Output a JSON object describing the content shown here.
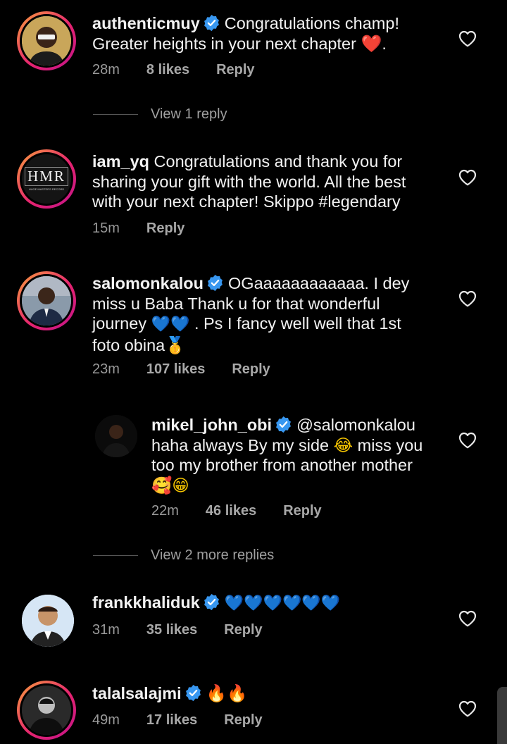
{
  "comments": [
    {
      "username": "authenticmuy",
      "verified": true,
      "text": "Congratulations champ! Greater heights in your next chapter",
      "trail_emoji": "❤️",
      "trail_end": ".",
      "time": "28m",
      "likes": "8 likes",
      "reply": "Reply",
      "view_replies": "View 1 reply"
    },
    {
      "username": "iam_yq",
      "verified": false,
      "text": "Congratulations and thank you for sharing your gift with  the world. All the best with your next chapter!  Skippo #legendary",
      "time": "15m",
      "reply": "Reply",
      "avatar_text": "HMR",
      "avatar_subtext": "HUGE MASTERS RECORD"
    },
    {
      "username": "salomonkalou",
      "verified": true,
      "text_a": "OGaaaaaaaaaaaa. I dey miss u Baba Thank u for that wonderful journey",
      "emoji_a": "💙💙",
      "text_b": ". Ps I fancy well well that 1st foto obina",
      "emoji_b": "🥇",
      "time": "23m",
      "likes": "107 likes",
      "reply": "Reply"
    },
    {
      "username": "mikel_john_obi",
      "verified": true,
      "text_a": "@salomonkalou haha always By my side",
      "emoji_a": "😂",
      "text_b": "miss you too my brother from another mother",
      "emoji_b": "🥰😁",
      "time": "22m",
      "likes": "46 likes",
      "reply": "Reply",
      "view_replies": "View 2 more replies"
    },
    {
      "username": "frankkhaliduk",
      "verified": true,
      "emoji": "💙💙💙💙💙💙",
      "time": "31m",
      "likes": "35 likes",
      "reply": "Reply"
    },
    {
      "username": "talalsalajmi",
      "verified": true,
      "emoji": "🔥🔥",
      "time": "49m",
      "likes": "17 likes",
      "reply": "Reply"
    }
  ],
  "colors": {
    "verified_blue": "#3897f0",
    "story_ring_start": "#f9a13a",
    "story_ring_end": "#c1138b",
    "meta_grey": "#9a9a9a"
  },
  "icons": [
    "verified-badge-icon",
    "heart-outline-icon"
  ]
}
